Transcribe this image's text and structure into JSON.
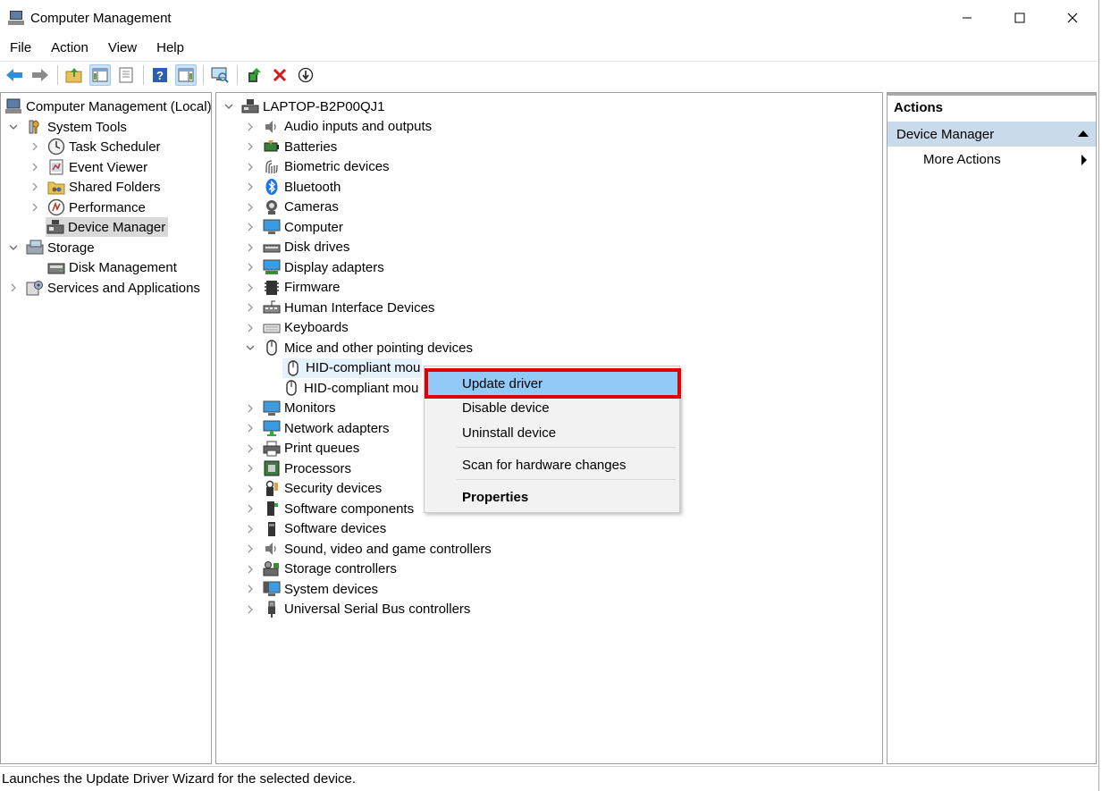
{
  "window": {
    "title": "Computer Management"
  },
  "menu": [
    "File",
    "Action",
    "View",
    "Help"
  ],
  "toolbar_icons": [
    "back-arrow-icon",
    "forward-arrow-icon",
    "up-folder-icon",
    "show-hide-tree-icon",
    "properties-icon",
    "help-icon",
    "show-hide-action-pane-icon",
    "scan-hardware-icon",
    "update-driver-icon",
    "uninstall-device-icon",
    "disable-device-icon"
  ],
  "left_tree": {
    "root": "Computer Management (Local)",
    "system_tools": "System Tools",
    "task_scheduler": "Task Scheduler",
    "event_viewer": "Event Viewer",
    "shared_folders": "Shared Folders",
    "performance": "Performance",
    "device_manager": "Device Manager",
    "storage": "Storage",
    "disk_management": "Disk Management",
    "services_apps": "Services and Applications"
  },
  "device_tree": {
    "computer": "LAPTOP-B2P00QJ1",
    "categories": [
      "Audio inputs and outputs",
      "Batteries",
      "Biometric devices",
      "Bluetooth",
      "Cameras",
      "Computer",
      "Disk drives",
      "Display adapters",
      "Firmware",
      "Human Interface Devices",
      "Keyboards",
      "Mice and other pointing devices"
    ],
    "mice_children": [
      "HID-compliant mou",
      "HID-compliant mou"
    ],
    "categories_after": [
      "Monitors",
      "Network adapters",
      "Print queues",
      "Processors",
      "Security devices",
      "Software components",
      "Software devices",
      "Sound, video and game controllers",
      "Storage controllers",
      "System devices",
      "Universal Serial Bus controllers"
    ]
  },
  "context_menu": {
    "update_driver": "Update driver",
    "disable_device": "Disable device",
    "uninstall_device": "Uninstall device",
    "scan_hardware": "Scan for hardware changes",
    "properties": "Properties",
    "highlight_color": "#e00000"
  },
  "actions": {
    "header": "Actions",
    "section": "Device Manager",
    "more_actions": "More Actions"
  },
  "status": "Launches the Update Driver Wizard for the selected device.",
  "colors": {
    "selection": "#91c9f7",
    "actions_section": "#c9daea"
  }
}
